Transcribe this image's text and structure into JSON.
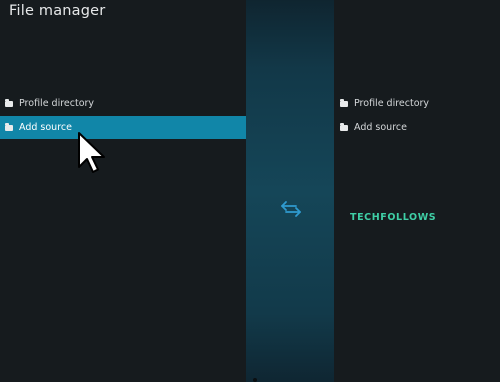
{
  "header": {
    "title": "File manager"
  },
  "left_pane": {
    "items": [
      {
        "label": "Profile directory",
        "selected": false
      },
      {
        "label": "Add source",
        "selected": true
      }
    ]
  },
  "right_pane": {
    "items": [
      {
        "label": "Profile directory"
      },
      {
        "label": "Add source"
      }
    ]
  },
  "center": {
    "icon": "swap-arrows-icon"
  },
  "watermark": {
    "text": "TECHFOLLOWS",
    "color": "#3fcfa6"
  },
  "colors": {
    "accent": "#1186a8",
    "background": "#161b1e",
    "center_strip": "#154658"
  }
}
